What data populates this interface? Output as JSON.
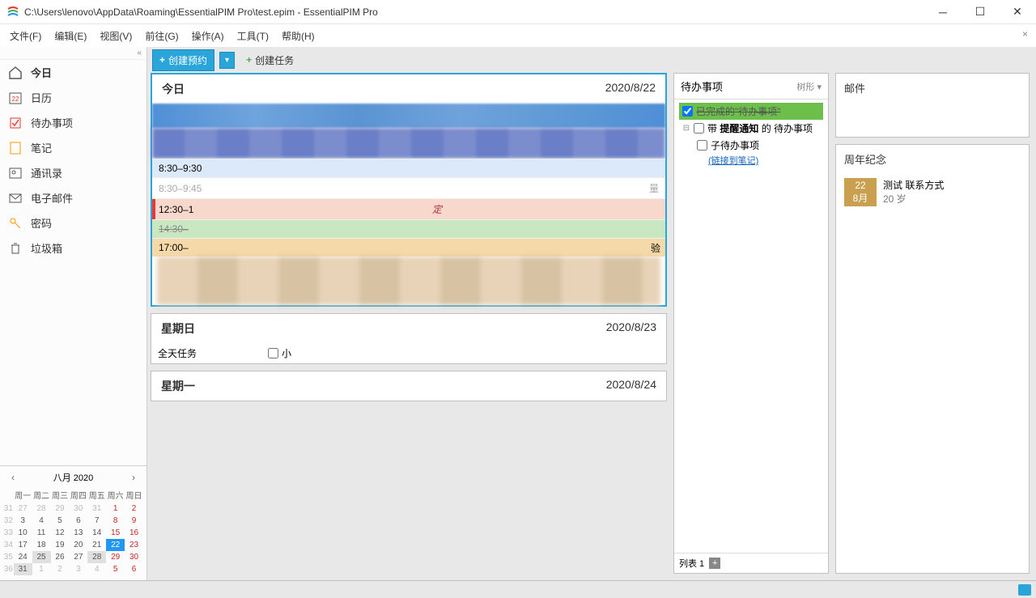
{
  "window": {
    "title": "C:\\Users\\lenovo\\AppData\\Roaming\\EssentialPIM Pro\\test.epim - EssentialPIM Pro"
  },
  "menu": {
    "file": "文件(F)",
    "edit": "编辑(E)",
    "view": "视图(V)",
    "goto": "前往(G)",
    "action": "操作(A)",
    "tools": "工具(T)",
    "help": "帮助(H)"
  },
  "sidebar": {
    "today": "今日",
    "calendar": "日历",
    "todo": "待办事项",
    "notes": "笔记",
    "contacts": "通讯录",
    "mail": "电子邮件",
    "passwords": "密码",
    "trash": "垃圾箱"
  },
  "minical": {
    "month_label": "八月    2020",
    "weekdays": [
      "周一",
      "周二",
      "周三",
      "周四",
      "周五",
      "周六",
      "周日"
    ],
    "weeks": [
      {
        "wk": "31",
        "days": [
          {
            "n": "27",
            "o": true
          },
          {
            "n": "28",
            "o": true
          },
          {
            "n": "29",
            "o": true
          },
          {
            "n": "30",
            "o": true
          },
          {
            "n": "31",
            "o": true
          },
          {
            "n": "1",
            "w": true
          },
          {
            "n": "2",
            "w": true
          }
        ]
      },
      {
        "wk": "32",
        "days": [
          {
            "n": "3"
          },
          {
            "n": "4"
          },
          {
            "n": "5"
          },
          {
            "n": "6"
          },
          {
            "n": "7"
          },
          {
            "n": "8",
            "w": true
          },
          {
            "n": "9",
            "w": true
          }
        ]
      },
      {
        "wk": "33",
        "days": [
          {
            "n": "10"
          },
          {
            "n": "11"
          },
          {
            "n": "12"
          },
          {
            "n": "13"
          },
          {
            "n": "14"
          },
          {
            "n": "15",
            "w": true
          },
          {
            "n": "16",
            "w": true
          }
        ]
      },
      {
        "wk": "34",
        "days": [
          {
            "n": "17"
          },
          {
            "n": "18"
          },
          {
            "n": "19"
          },
          {
            "n": "20"
          },
          {
            "n": "21"
          },
          {
            "n": "22",
            "t": true
          },
          {
            "n": "23",
            "w": true
          }
        ]
      },
      {
        "wk": "35",
        "days": [
          {
            "n": "24"
          },
          {
            "n": "25",
            "s": true
          },
          {
            "n": "26"
          },
          {
            "n": "27"
          },
          {
            "n": "28",
            "s": true
          },
          {
            "n": "29",
            "w": true
          },
          {
            "n": "30",
            "w": true
          }
        ]
      },
      {
        "wk": "36",
        "days": [
          {
            "n": "31",
            "s": true
          },
          {
            "n": "1",
            "o": true
          },
          {
            "n": "2",
            "o": true
          },
          {
            "n": "3",
            "o": true
          },
          {
            "n": "4",
            "o": true
          },
          {
            "n": "5",
            "o": true,
            "w": true
          },
          {
            "n": "6",
            "o": true,
            "w": true
          }
        ]
      }
    ]
  },
  "toolbar": {
    "new_appt": "创建预约",
    "new_task": "创建任务"
  },
  "days": {
    "today_name": "今日",
    "today_date": "2020/8/22",
    "sun_name": "星期日",
    "sun_date": "2020/8/23",
    "sun_allday": "全天任务",
    "sun_item": "小",
    "mon_name": "星期一",
    "mon_date": "2020/8/24"
  },
  "events": {
    "e1_time": "8:30–9:30",
    "e2_time": "8:30–9:45",
    "e3_time": "12:30–1",
    "e3_mid": "定",
    "e4_time": "14:30–",
    "e5_time": "17:00–",
    "e5_right": "验",
    "e2_right": "量"
  },
  "todo": {
    "title": "待办事项",
    "view_label": "树形",
    "done_label": "已完成的\"待办事项\"",
    "reminder_label_pre": "带 ",
    "reminder_label_bold": "提醒通知",
    "reminder_label_post": " 的 待办事项",
    "child_label": "子待办事项",
    "link_label": "(链接到笔记)",
    "list_tab": "列表 1"
  },
  "right": {
    "mail_title": "邮件",
    "anniv_title": "周年纪念",
    "anniv_day": "22",
    "anniv_month": "8月",
    "anniv_name": "测试 联系方式",
    "anniv_age": "20 岁"
  }
}
